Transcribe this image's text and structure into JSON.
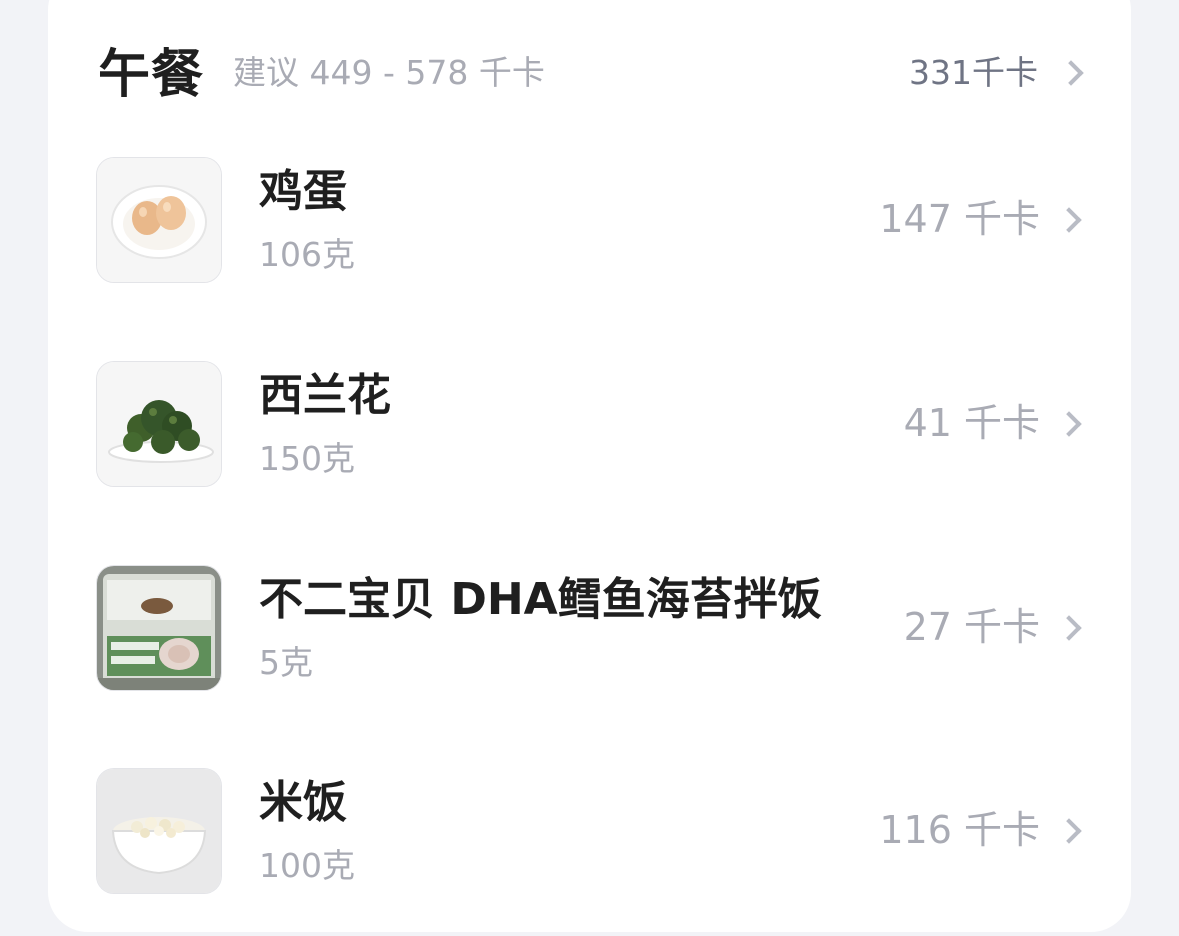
{
  "meal": {
    "title": "午餐",
    "suggestion": "建议 449 - 578 千卡",
    "total": "331千卡"
  },
  "foods": [
    {
      "name": "鸡蛋",
      "weight": "106克",
      "kcal": "147 千卡",
      "icon": "eggs-icon"
    },
    {
      "name": "西兰花",
      "weight": "150克",
      "kcal": "41 千卡",
      "icon": "broccoli-icon"
    },
    {
      "name": "不二宝贝 DHA鳕鱼海苔拌饭",
      "weight": "5克",
      "kcal": "27 千卡",
      "icon": "package-icon"
    },
    {
      "name": "米饭",
      "weight": "100克",
      "kcal": "116 千卡",
      "icon": "rice-bowl-icon"
    }
  ]
}
